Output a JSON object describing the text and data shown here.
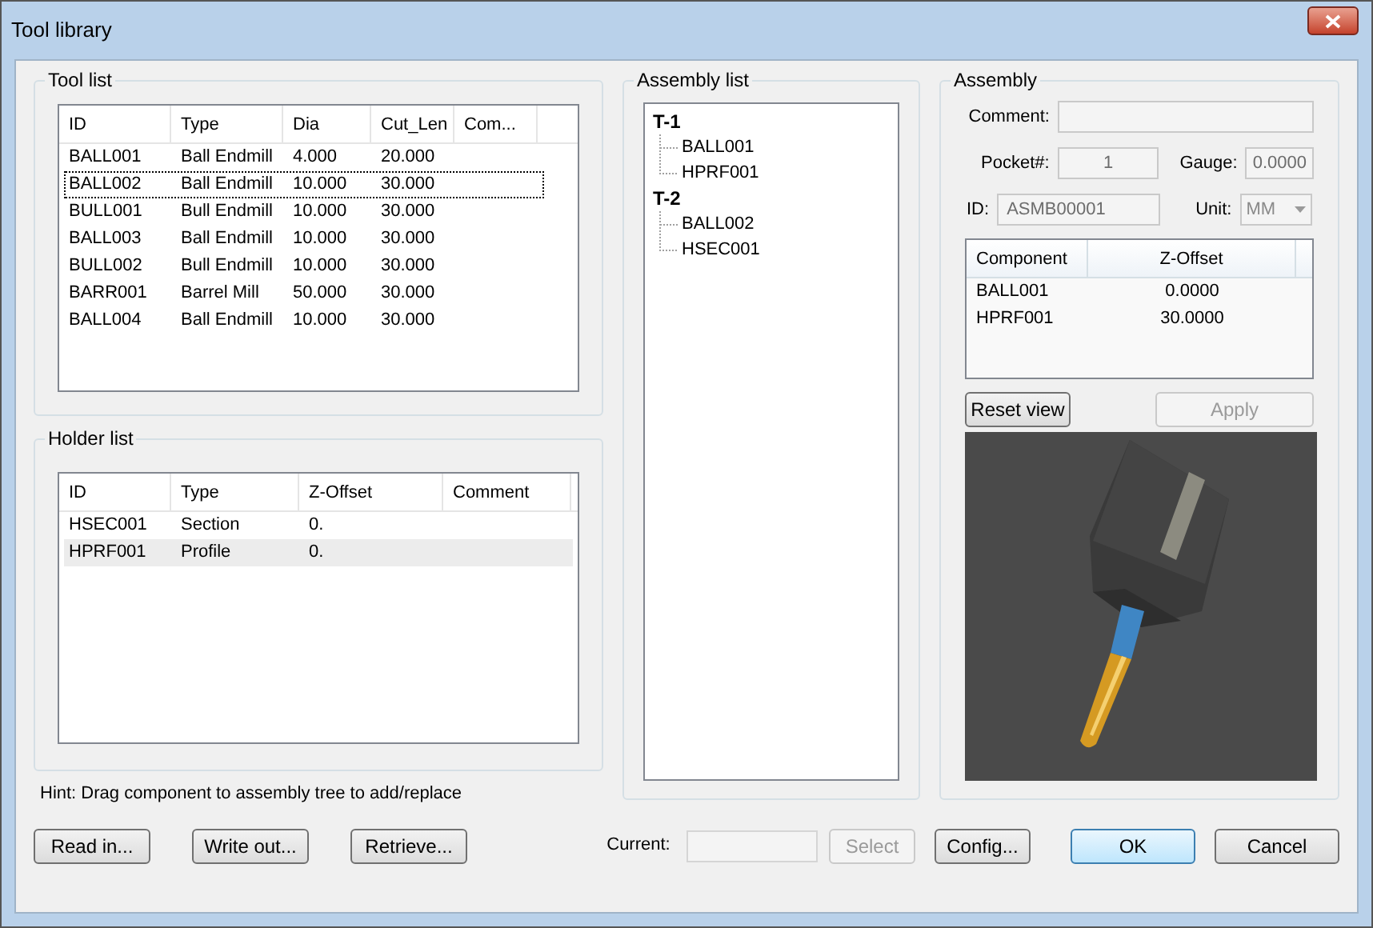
{
  "window": {
    "title": "Tool library"
  },
  "tool_list": {
    "title": "Tool list",
    "columns": [
      "ID",
      "Type",
      "Dia",
      "Cut_Len",
      "Com..."
    ],
    "rows": [
      {
        "cells": [
          "BALL001",
          "Ball Endmill",
          "4.000",
          "20.000"
        ],
        "selected": false
      },
      {
        "cells": [
          "BALL002",
          "Ball Endmill",
          "10.000",
          "30.000"
        ],
        "selected": true
      },
      {
        "cells": [
          "BULL001",
          "Bull Endmill",
          "10.000",
          "30.000"
        ],
        "selected": false
      },
      {
        "cells": [
          "BALL003",
          "Ball Endmill",
          "10.000",
          "30.000"
        ],
        "selected": false
      },
      {
        "cells": [
          "BULL002",
          "Bull Endmill",
          "10.000",
          "30.000"
        ],
        "selected": false
      },
      {
        "cells": [
          "BARR001",
          "Barrel Mill",
          "50.000",
          "30.000"
        ],
        "selected": false
      },
      {
        "cells": [
          "BALL004",
          "Ball Endmill",
          "10.000",
          "30.000"
        ],
        "selected": false
      }
    ]
  },
  "holder_list": {
    "title": "Holder list",
    "columns": [
      "ID",
      "Type",
      "Z-Offset",
      "Comment"
    ],
    "rows": [
      {
        "cells": [
          "HSEC001",
          "Section",
          "0."
        ],
        "selected": false
      },
      {
        "cells": [
          "HPRF001",
          "Profile",
          "0."
        ],
        "selected": true
      }
    ]
  },
  "hint": "Hint: Drag component to assembly tree to add/replace",
  "assembly_list": {
    "title": "Assembly list",
    "tree": [
      {
        "label": "T-1",
        "children": [
          {
            "label": "BALL001"
          },
          {
            "label": "HPRF001"
          }
        ]
      },
      {
        "label": "T-2",
        "children": [
          {
            "label": "BALL002"
          },
          {
            "label": "HSEC001"
          }
        ]
      }
    ]
  },
  "assembly": {
    "title": "Assembly",
    "comment": {
      "label": "Comment:"
    },
    "pocket": {
      "label": "Pocket#:",
      "value": "1"
    },
    "gauge": {
      "label": "Gauge:",
      "value": "0.0000"
    },
    "id": {
      "label": "ID:",
      "value": "ASMB00001"
    },
    "unit": {
      "label": "Unit:",
      "value": "MM"
    },
    "components": {
      "columns": [
        "Component",
        "Z-Offset"
      ],
      "rows": [
        [
          "BALL001",
          "0.0000"
        ],
        [
          "HPRF001",
          "30.0000"
        ]
      ]
    },
    "buttons": [
      {
        "label": "Reset view",
        "disabled": false
      },
      {
        "label": "Apply",
        "disabled": true
      }
    ]
  },
  "bottom_left_buttons": [
    {
      "label": "Read in...",
      "disabled": false
    },
    {
      "label": "Write out...",
      "disabled": false
    },
    {
      "label": "Retrieve...",
      "disabled": false
    }
  ],
  "current": {
    "label": "Current:"
  },
  "select_button": {
    "label": "Select",
    "disabled": true
  },
  "config_button": {
    "label": "Config...",
    "disabled": false
  },
  "dialog_buttons": [
    {
      "label": "OK",
      "default": true
    },
    {
      "label": "Cancel",
      "default": false
    }
  ]
}
